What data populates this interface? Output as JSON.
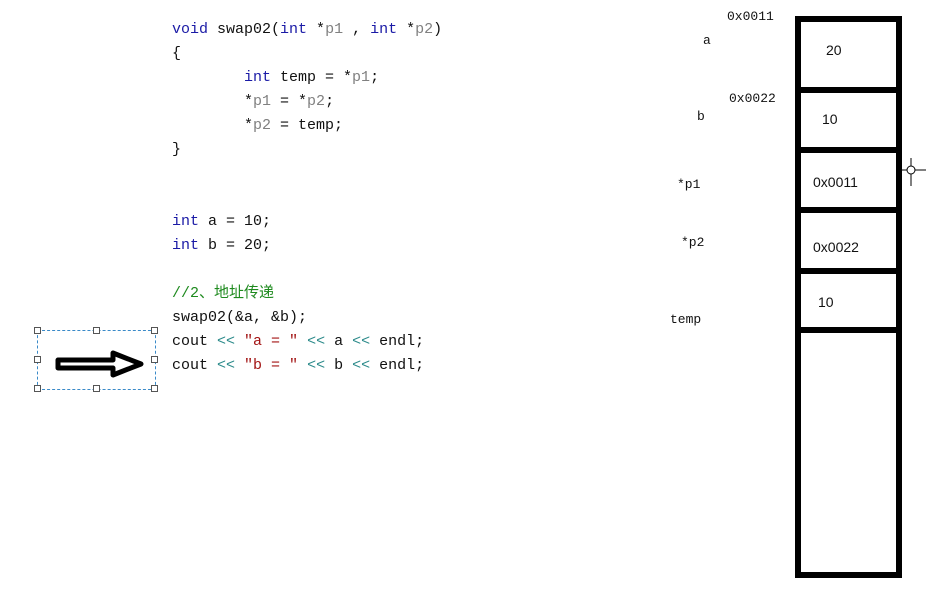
{
  "code_lines": [
    [
      {
        "t": "void",
        "c": "kw"
      },
      {
        "t": " swap02(",
        "c": ""
      },
      {
        "t": "int",
        "c": "kw"
      },
      {
        "t": " *",
        "c": ""
      },
      {
        "t": "p1",
        "c": "param"
      },
      {
        "t": " , ",
        "c": ""
      },
      {
        "t": "int",
        "c": "kw"
      },
      {
        "t": " *",
        "c": ""
      },
      {
        "t": "p2",
        "c": "param"
      },
      {
        "t": ")",
        "c": ""
      }
    ],
    [
      {
        "t": "{",
        "c": ""
      }
    ],
    [
      {
        "t": "        ",
        "c": ""
      },
      {
        "t": "int",
        "c": "kw"
      },
      {
        "t": " temp = *",
        "c": ""
      },
      {
        "t": "p1",
        "c": "param"
      },
      {
        "t": ";",
        "c": ""
      }
    ],
    [
      {
        "t": "        *",
        "c": ""
      },
      {
        "t": "p1",
        "c": "param"
      },
      {
        "t": " = *",
        "c": ""
      },
      {
        "t": "p2",
        "c": "param"
      },
      {
        "t": ";",
        "c": ""
      }
    ],
    [
      {
        "t": "        *",
        "c": ""
      },
      {
        "t": "p2",
        "c": "param"
      },
      {
        "t": " = temp;",
        "c": ""
      }
    ],
    [
      {
        "t": "}",
        "c": ""
      }
    ],
    [],
    [],
    [
      {
        "t": "int",
        "c": "kw"
      },
      {
        "t": " a = 10;",
        "c": ""
      }
    ],
    [
      {
        "t": "int",
        "c": "kw"
      },
      {
        "t": " b = 20;",
        "c": ""
      }
    ],
    [],
    [
      {
        "t": "//2、地址传递",
        "c": "cm"
      }
    ],
    [
      {
        "t": "swap02(&a, &b);",
        "c": ""
      }
    ],
    [
      {
        "t": "cout ",
        "c": ""
      },
      {
        "t": "<<",
        "c": "op"
      },
      {
        "t": " ",
        "c": ""
      },
      {
        "t": "\"a = \"",
        "c": "str"
      },
      {
        "t": " ",
        "c": ""
      },
      {
        "t": "<<",
        "c": "op"
      },
      {
        "t": " a ",
        "c": ""
      },
      {
        "t": "<<",
        "c": "op"
      },
      {
        "t": " endl;",
        "c": ""
      }
    ],
    [
      {
        "t": "cout ",
        "c": ""
      },
      {
        "t": "<<",
        "c": "op"
      },
      {
        "t": " ",
        "c": ""
      },
      {
        "t": "\"b = \"",
        "c": "str"
      },
      {
        "t": " ",
        "c": ""
      },
      {
        "t": "<<",
        "c": "op"
      },
      {
        "t": " b ",
        "c": ""
      },
      {
        "t": "<<",
        "c": "op"
      },
      {
        "t": " endl;",
        "c": ""
      }
    ]
  ],
  "memory": {
    "cells": [
      {
        "name": "a",
        "address": "0x0011",
        "value": "20"
      },
      {
        "name": "b",
        "address": "0x0022",
        "value": "10"
      },
      {
        "name": "*p1",
        "value": "0x0011"
      },
      {
        "name": "*p2",
        "value": "0x0022"
      },
      {
        "name": "temp",
        "value": "10"
      }
    ]
  },
  "colors": {
    "keyword": "#1a1aa6",
    "comment": "#1e8a1e",
    "string": "#a31515",
    "operator": "#2b8a8a",
    "selection": "#3a8ac8"
  }
}
